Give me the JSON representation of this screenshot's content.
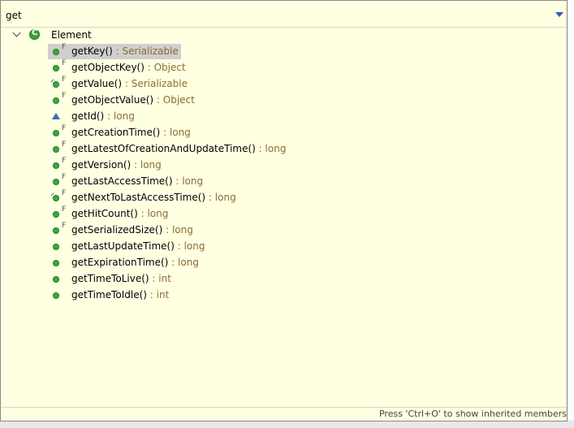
{
  "filter": {
    "value": "get"
  },
  "root": {
    "label": "Element"
  },
  "members": [
    {
      "name": "getKey()",
      "type": ": Serializable",
      "icon": "public-method-icon",
      "final": true,
      "selected": true
    },
    {
      "name": "getObjectKey()",
      "type": ": Object",
      "icon": "public-method-icon",
      "final": true
    },
    {
      "name": "getValue()",
      "type": ": Serializable",
      "icon": "public-method-icon",
      "final": true,
      "deprecated": true
    },
    {
      "name": "getObjectValue()",
      "type": ": Object",
      "icon": "public-method-icon",
      "final": true
    },
    {
      "name": "getId()",
      "type": ": long",
      "icon": "protected-method-icon",
      "final": false
    },
    {
      "name": "getCreationTime()",
      "type": ": long",
      "icon": "public-method-icon",
      "final": true
    },
    {
      "name": "getLatestOfCreationAndUpdateTime()",
      "type": ": long",
      "icon": "public-method-icon",
      "final": true
    },
    {
      "name": "getVersion()",
      "type": ": long",
      "icon": "public-method-icon",
      "final": true
    },
    {
      "name": "getLastAccessTime()",
      "type": ": long",
      "icon": "public-method-icon",
      "final": true
    },
    {
      "name": "getNextToLastAccessTime()",
      "type": ": long",
      "icon": "public-method-icon",
      "final": true,
      "deprecated": true
    },
    {
      "name": "getHitCount()",
      "type": ": long",
      "icon": "public-method-icon",
      "final": true
    },
    {
      "name": "getSerializedSize()",
      "type": ": long",
      "icon": "public-method-icon",
      "final": true
    },
    {
      "name": "getLastUpdateTime()",
      "type": ": long",
      "icon": "public-method-icon",
      "final": false
    },
    {
      "name": "getExpirationTime()",
      "type": ": long",
      "icon": "public-method-icon",
      "final": false
    },
    {
      "name": "getTimeToLive()",
      "type": ": int",
      "icon": "public-method-icon",
      "final": false
    },
    {
      "name": "getTimeToIdle()",
      "type": ": int",
      "icon": "public-method-icon",
      "final": false
    }
  ],
  "status": {
    "text": "Press 'Ctrl+O' to show inherited members"
  },
  "colors": {
    "background": "#ffffe1",
    "type_text": "#8c6c30",
    "selection": "#cfcfcf"
  }
}
